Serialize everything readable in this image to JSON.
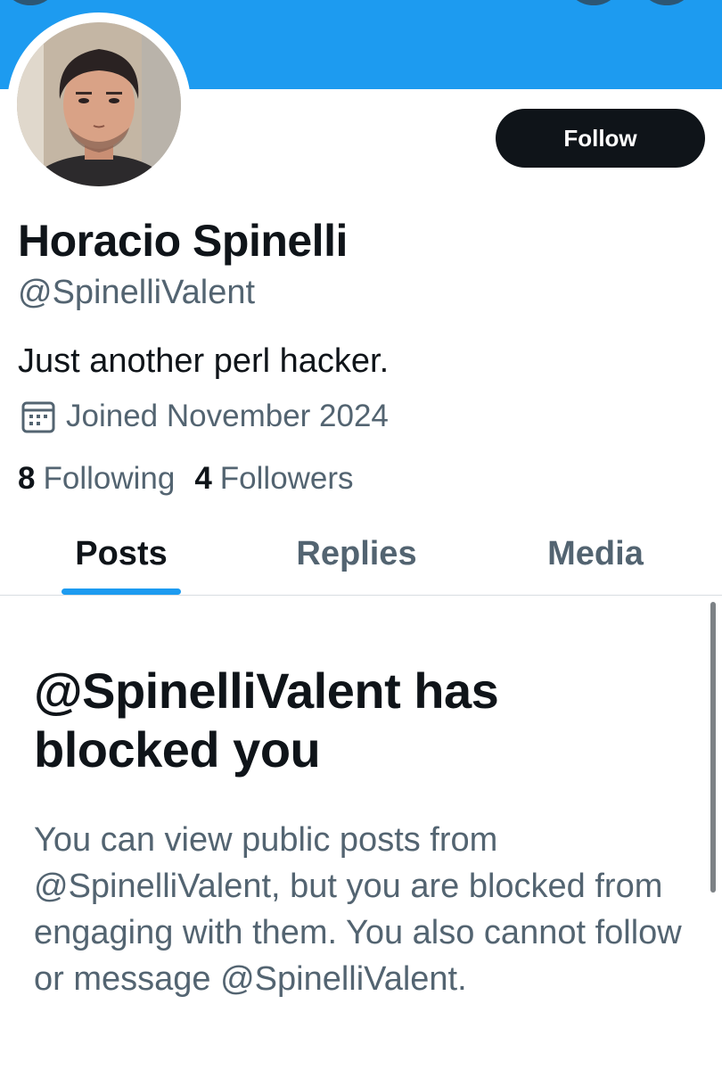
{
  "profile": {
    "name": "Horacio Spinelli",
    "handle": "@SpinelliValent",
    "bio": "Just another perl hacker.",
    "joined": "Joined November 2024",
    "follow_label": "Follow",
    "stats": {
      "following_count": "8",
      "following_label": "Following",
      "followers_count": "4",
      "followers_label": "Followers"
    }
  },
  "tabs": [
    {
      "label": "Posts",
      "active": true
    },
    {
      "label": "Replies",
      "active": false
    },
    {
      "label": "Media",
      "active": false
    }
  ],
  "blocked_notice": {
    "title": "@SpinelliValent has blocked you",
    "body": "You can view public posts from @SpinelliValent, but you are blocked from engaging with them. You also cannot follow or message @SpinelliValent."
  },
  "icons": {
    "joined": "calendar-icon"
  },
  "colors": {
    "banner": "#1d9bf0",
    "accent": "#1d9bf0",
    "primary_text": "#0f1419",
    "secondary_text": "#536471",
    "follow_button": "#0f1419"
  }
}
